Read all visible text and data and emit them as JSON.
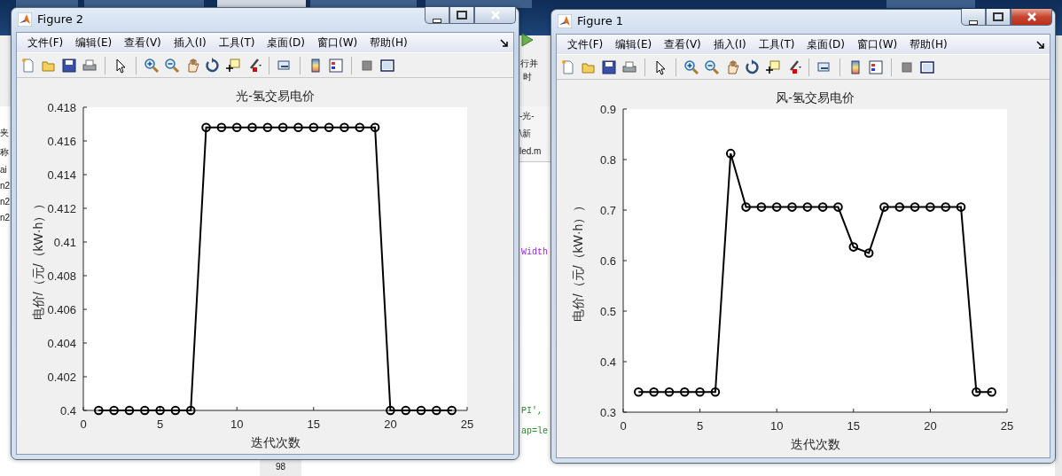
{
  "background": {
    "left_panel": [
      "夹",
      "称",
      "ai",
      "n2",
      "n2",
      "n2"
    ],
    "ribbon": [
      "行并",
      "时"
    ],
    "path_rows": [
      "-光-",
      "\\新",
      "led.m"
    ],
    "code": [
      "Width",
      "PI',",
      "ap=le"
    ],
    "line_number": "98",
    "toolstrip_tabs": [
      {
        "selected": false
      },
      {
        "selected": false
      },
      {
        "selected": true
      },
      {
        "selected": false
      },
      {
        "selected": false
      },
      {
        "selected": false
      }
    ]
  },
  "windows": [
    {
      "title": "Figure 2",
      "active": false,
      "menu": [
        "文件(F)",
        "编辑(E)",
        "查看(V)",
        "插入(I)",
        "工具(T)",
        "桌面(D)",
        "窗口(W)",
        "帮助(H)"
      ],
      "chart_data": {
        "type": "line",
        "title": "光-氢交易电价",
        "xlabel": "迭代次数",
        "ylabel": "电价/（元/（kW·h））",
        "x": [
          1,
          2,
          3,
          4,
          5,
          6,
          7,
          8,
          9,
          10,
          11,
          12,
          13,
          14,
          15,
          16,
          17,
          18,
          19,
          20,
          21,
          22,
          23,
          24
        ],
        "xlim": [
          0,
          25
        ],
        "ylim": [
          0.4,
          0.418
        ],
        "xticks": [
          0,
          5,
          10,
          15,
          20,
          25
        ],
        "yticks": [
          0.4,
          0.402,
          0.404,
          0.406,
          0.408,
          0.41,
          0.412,
          0.414,
          0.416,
          0.418
        ],
        "series": [
          {
            "color": "#000000",
            "marker": "o",
            "values": [
              0.4,
              0.4,
              0.4,
              0.4,
              0.4,
              0.4,
              0.4,
              0.4168,
              0.4168,
              0.4168,
              0.4168,
              0.4168,
              0.4168,
              0.4168,
              0.4168,
              0.4168,
              0.4168,
              0.4168,
              0.4168,
              0.4,
              0.4,
              0.4,
              0.4,
              0.4
            ]
          }
        ]
      }
    },
    {
      "title": "Figure 1",
      "active": true,
      "menu": [
        "文件(F)",
        "编辑(E)",
        "查看(V)",
        "插入(I)",
        "工具(T)",
        "桌面(D)",
        "窗口(W)",
        "帮助(H)"
      ],
      "chart_data": {
        "type": "line",
        "title": "风-氢交易电价",
        "xlabel": "迭代次数",
        "ylabel": "电价/（元/（kW·h））",
        "x": [
          1,
          2,
          3,
          4,
          5,
          6,
          7,
          8,
          9,
          10,
          11,
          12,
          13,
          14,
          15,
          16,
          17,
          18,
          19,
          20,
          21,
          22,
          23,
          24
        ],
        "xlim": [
          0,
          25
        ],
        "ylim": [
          0.3,
          0.9
        ],
        "xticks": [
          0,
          5,
          10,
          15,
          20,
          25
        ],
        "yticks": [
          0.3,
          0.4,
          0.5,
          0.6,
          0.7,
          0.8,
          0.9
        ],
        "series": [
          {
            "color": "#000000",
            "marker": "o",
            "values": [
              0.34,
              0.34,
              0.34,
              0.34,
              0.34,
              0.34,
              0.812,
              0.706,
              0.706,
              0.706,
              0.706,
              0.706,
              0.706,
              0.706,
              0.627,
              0.615,
              0.706,
              0.706,
              0.706,
              0.706,
              0.706,
              0.706,
              0.34,
              0.34
            ]
          }
        ]
      }
    }
  ]
}
